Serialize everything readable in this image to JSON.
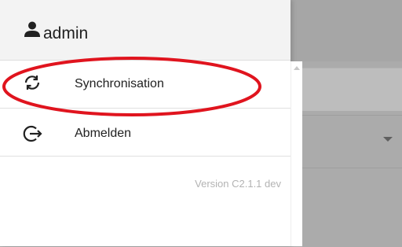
{
  "drawer": {
    "user": {
      "icon": "person-icon",
      "name": "admin"
    },
    "menu": [
      {
        "icon": "sync-icon",
        "label": "Synchronisation"
      },
      {
        "icon": "logout-icon",
        "label": "Abmelden"
      }
    ],
    "version": "Version C2.1.1 dev"
  },
  "annotation": {
    "shape": "ellipse",
    "color": "#e0141e",
    "target": "Synchronisation"
  },
  "colors": {
    "overlay": "#ababab",
    "header_bg": "#f3f3f3",
    "drawer_bg": "#ffffff",
    "text": "#212121",
    "version_text": "#b3b3b3"
  }
}
